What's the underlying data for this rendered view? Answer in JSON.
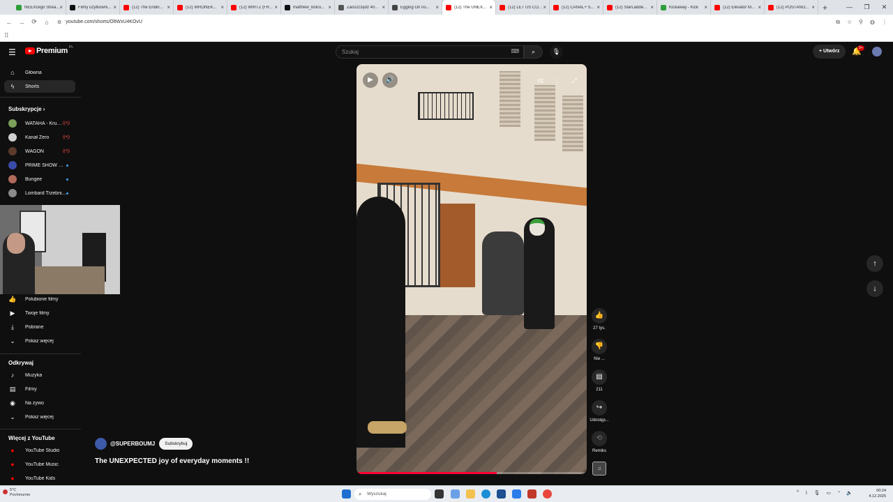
{
  "browser": {
    "tabs": [
      {
        "title": "NEEXcego Strea...",
        "color": "#2e9e3a",
        "active": false
      },
      {
        "title": "Filmy użytkowni...",
        "color": "#111111",
        "active": false
      },
      {
        "title": "(12) The Endin...",
        "color": "#ff0000",
        "active": false
      },
      {
        "title": "(12) WRONEK...",
        "color": "#ff0000",
        "active": false
      },
      {
        "title": "(12) WIRTZ (FR...",
        "color": "#ff0000",
        "active": false
      },
      {
        "title": "matthew_bolco...",
        "color": "#111111",
        "active": false
      },
      {
        "title": "Zaoszczędź 40...",
        "color": "#555555",
        "active": false
      },
      {
        "title": "Egging On no...",
        "color": "#444444",
        "active": false
      },
      {
        "title": "(12) The UNEX...",
        "color": "#ff0000",
        "active": true
      },
      {
        "title": "(12) LET US CO...",
        "color": "#ff0000",
        "active": false
      },
      {
        "title": "(12) CANAL+ S...",
        "color": "#ff0000",
        "active": false
      },
      {
        "title": "(12) StarLadde...",
        "color": "#ff0000",
        "active": false
      },
      {
        "title": "Kickaway - Kick",
        "color": "#2e9e3a",
        "active": false
      },
      {
        "title": "(12) Elevator M...",
        "color": "#ff0000",
        "active": false
      },
      {
        "title": "(12) POSTANO...",
        "color": "#ff0000",
        "active": false
      }
    ],
    "new_tab": "+",
    "window_controls": [
      "—",
      "❐",
      "✕"
    ],
    "url": "youtube.com/shorts/OltWxU4KOvU"
  },
  "header": {
    "logo_text": "Premium",
    "logo_region": "PL",
    "search_placeholder": "Szukaj",
    "create_label": "Utwórz",
    "notif_badge": "9+"
  },
  "sidebar": {
    "main": [
      {
        "label": "Główna",
        "icon": "⌂"
      },
      {
        "label": "Shorts",
        "icon": "ϟ",
        "active": true
      }
    ],
    "subs_title": "Subskrypcje",
    "subs": [
      {
        "label": "WATAHA - Krule...",
        "color": "#7aa05a",
        "status": "live"
      },
      {
        "label": "Kanał Zero",
        "color": "#d0d0d0",
        "status": "live"
      },
      {
        "label": "WAGON",
        "color": "#5b3b2b",
        "status": "live"
      },
      {
        "label": "PRIME SHOW M...",
        "color": "#3b4ba8",
        "status": "new"
      },
      {
        "label": "Bungee",
        "color": "#b06a5a",
        "status": "new"
      },
      {
        "label": "Lombard Trzebni...",
        "color": "#8a8a8a",
        "status": "new"
      }
    ],
    "live_label": "((•))",
    "you": [
      {
        "label": "Polubione filmy",
        "icon": "👍"
      },
      {
        "label": "Twoje filmy",
        "icon": "▶"
      },
      {
        "label": "Pobrane",
        "icon": "⤓"
      },
      {
        "label": "Pokaż więcej",
        "icon": "⌄"
      }
    ],
    "explore_title": "Odkrywaj",
    "explore": [
      {
        "label": "Muzyka",
        "icon": "♪"
      },
      {
        "label": "Filmy",
        "icon": "▤"
      },
      {
        "label": "Na żywo",
        "icon": "◉"
      },
      {
        "label": "Pokaż więcej",
        "icon": "⌄"
      }
    ],
    "more_title": "Więcej z YouTube",
    "more": [
      {
        "label": "YouTube Studio"
      },
      {
        "label": "YouTube Music"
      },
      {
        "label": "YouTube Kids"
      }
    ]
  },
  "video": {
    "progress": 0.61,
    "actions": {
      "like_count": "27 tys.",
      "dislike_label": "Nie ...",
      "comments_count": "211",
      "share_label": "Udostęp...",
      "remix_label": "Remiks"
    }
  },
  "channel": {
    "handle": "@SUPERBOUMJ",
    "subscribe_label": "Subskrybuj",
    "title": "The UNEXPECTED joy of everyday moments !!"
  },
  "taskbar": {
    "weather_temp": "5°C",
    "weather_desc": "Pochmurnie",
    "search_placeholder": "Wyszukaj",
    "time": "00:24",
    "date": "4.12.2025"
  },
  "colors": {
    "accent": "#ff0000",
    "background": "#0f0f0f",
    "progress": "#ff0033"
  }
}
